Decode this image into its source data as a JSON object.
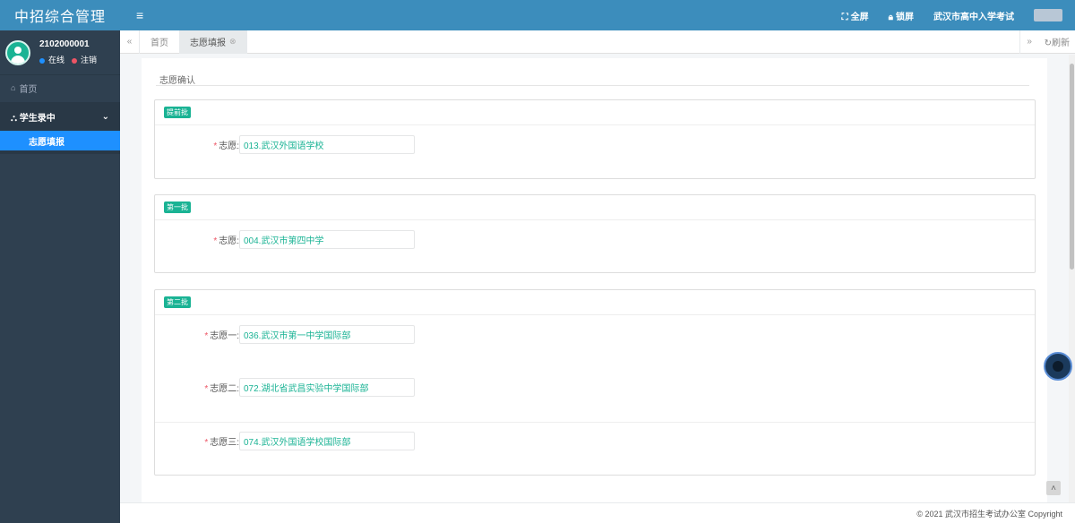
{
  "logo": "中招综合管理",
  "user": {
    "id": "2102000001",
    "status_online": "在线",
    "status_logout": "注销"
  },
  "sidebar": {
    "home": "首页",
    "group": "学生录中",
    "sub_item": "志愿填报"
  },
  "topbar": {
    "fullscreen": "全屏",
    "lock": "锁屏",
    "org": "武汉市高中入学考试"
  },
  "tabs": {
    "home": "首页",
    "active": "志愿填报",
    "refresh": "刷新"
  },
  "form": {
    "title": "志愿确认",
    "cards": [
      {
        "badge": "提前批",
        "rows": [
          {
            "label": "志愿:",
            "value": "013.武汉外国语学校"
          }
        ]
      },
      {
        "badge": "第一批",
        "rows": [
          {
            "label": "志愿:",
            "value": "004.武汉市第四中学"
          }
        ]
      },
      {
        "badge": "第二批",
        "rows": [
          {
            "label": "志愿一:",
            "value": "036.武汉市第一中学国际部"
          },
          {
            "label": "志愿二:",
            "value": "072.湖北省武昌实验中学国际部"
          },
          {
            "label": "志愿三:",
            "value": "074.武汉外国语学校国际部"
          }
        ]
      }
    ]
  },
  "footer": "© 2021 武汉市招生考试办公室 Copyright",
  "colors": {
    "header": "#3c8dbc",
    "sidebar": "#2f4050",
    "accent": "#1ab394",
    "active_nav": "#1e90ff"
  }
}
